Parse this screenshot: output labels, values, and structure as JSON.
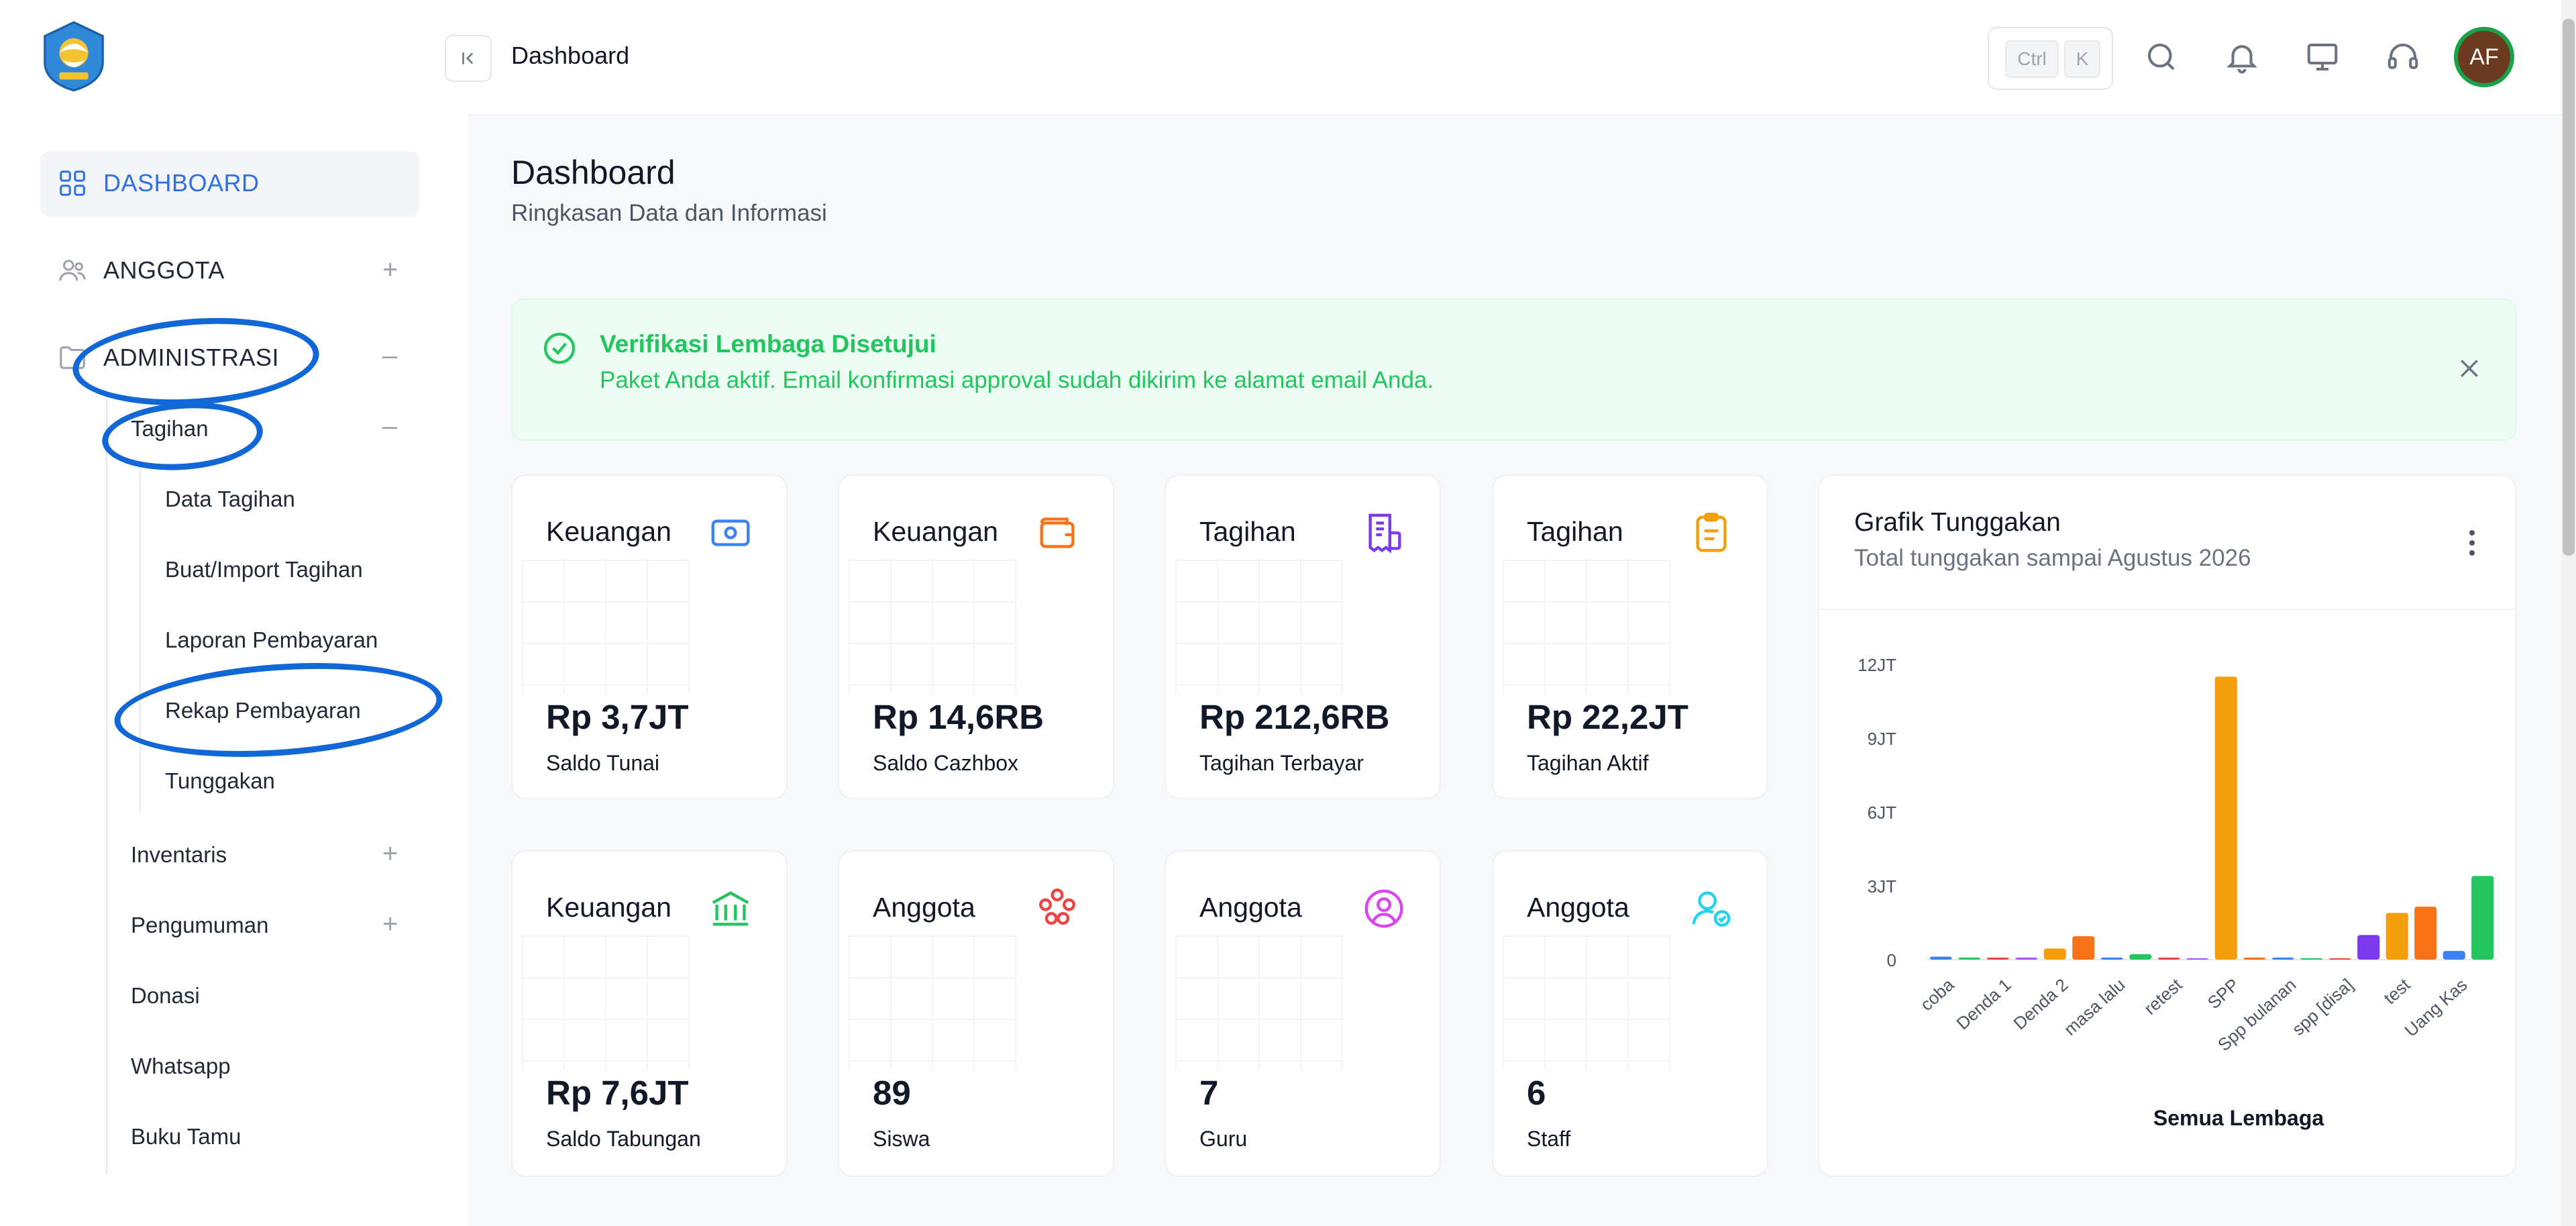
{
  "sidebar": {
    "items": [
      {
        "label": "DASHBOARD"
      },
      {
        "label": "ANGGOTA"
      },
      {
        "label": "ADMINISTRASI"
      }
    ],
    "admin_sub": [
      {
        "label": "Tagihan"
      },
      {
        "label": "Inventaris"
      },
      {
        "label": "Pengumuman"
      },
      {
        "label": "Donasi"
      },
      {
        "label": "Whatsapp"
      },
      {
        "label": "Buku Tamu"
      }
    ],
    "tagihan_sub": [
      {
        "label": "Data Tagihan"
      },
      {
        "label": "Buat/Import Tagihan"
      },
      {
        "label": "Laporan Pembayaran"
      },
      {
        "label": "Rekap Pembayaran"
      },
      {
        "label": "Tunggakan"
      }
    ]
  },
  "header": {
    "title": "Dashboard",
    "kbd": [
      "Ctrl",
      "K"
    ],
    "avatar_initials": "AF"
  },
  "page": {
    "title": "Dashboard",
    "subtitle": "Ringkasan Data dan Informasi"
  },
  "alert": {
    "title": "Verifikasi Lembaga Disetujui",
    "text": "Paket Anda aktif. Email konfirmasi approval sudah dikirim ke alamat email Anda."
  },
  "cards": [
    {
      "title": "Keuangan",
      "value": "Rp 3,7JT",
      "label": "Saldo Tunai",
      "icon": "cash-icon",
      "color": "#3b82f6"
    },
    {
      "title": "Keuangan",
      "value": "Rp 14,6RB",
      "label": "Saldo Cazhbox",
      "icon": "wallet-icon",
      "color": "#f97316"
    },
    {
      "title": "Tagihan",
      "value": "Rp 212,6RB",
      "label": "Tagihan Terbayar",
      "icon": "invoice-icon",
      "color": "#7c3aed"
    },
    {
      "title": "Tagihan",
      "value": "Rp 22,2JT",
      "label": "Tagihan Aktif",
      "icon": "clipboard-icon",
      "color": "#f59e0b"
    },
    {
      "title": "Keuangan",
      "value": "Rp 7,6JT",
      "label": "Saldo Tabungan",
      "icon": "bank-icon",
      "color": "#22c55e"
    },
    {
      "title": "Anggota",
      "value": "89",
      "label": "Siswa",
      "icon": "group-icon",
      "color": "#ef4444"
    },
    {
      "title": "Anggota",
      "value": "7",
      "label": "Guru",
      "icon": "user-circle-icon",
      "color": "#d946ef"
    },
    {
      "title": "Anggota",
      "value": "6",
      "label": "Staff",
      "icon": "user-check-icon",
      "color": "#22d3ee"
    }
  ],
  "chart": {
    "title": "Grafik Tunggakan",
    "subtitle": "Total tunggakan sampai Agustus 2026"
  },
  "chart_data": {
    "type": "bar",
    "xlabel": "Semua Lembaga",
    "ylabel": "",
    "ylim": [
      0,
      12000000
    ],
    "yticks": [
      0,
      3000000,
      6000000,
      9000000,
      12000000
    ],
    "ytick_labels": [
      "0",
      "3JT",
      "6JT",
      "9JT",
      "12JT"
    ],
    "categories": [
      "coba",
      "Denda 1",
      "Denda 2",
      "masa lalu",
      "retest",
      "SPP",
      "Spp bulanan",
      "spp [disa]",
      "test",
      "Uang Kas"
    ],
    "category_labels_shown": [
      "coba",
      "Denda 1",
      "Denda 2",
      "masa lalu",
      "retest",
      "SPP",
      "Spp bulanan",
      "spp [disa]",
      "test",
      "Uang Kas"
    ],
    "bars": [
      {
        "value": 120000,
        "color": "#3b82f6"
      },
      {
        "value": 80000,
        "color": "#22c55e"
      },
      {
        "value": 40000,
        "color": "#ef4444"
      },
      {
        "value": 40000,
        "color": "#a855f7"
      },
      {
        "value": 450000,
        "color": "#f59e0b"
      },
      {
        "value": 950000,
        "color": "#f97316"
      },
      {
        "value": 20000,
        "color": "#3b82f6"
      },
      {
        "value": 220000,
        "color": "#22c55e"
      },
      {
        "value": 20000,
        "color": "#ef4444"
      },
      {
        "value": 0,
        "color": "#a855f7"
      },
      {
        "value": 11500000,
        "color": "#f59e0b"
      },
      {
        "value": 80000,
        "color": "#f97316"
      },
      {
        "value": 60000,
        "color": "#3b82f6"
      },
      {
        "value": 0,
        "color": "#22c55e"
      },
      {
        "value": 0,
        "color": "#ef4444"
      },
      {
        "value": 1000000,
        "color": "#7c3aed"
      },
      {
        "value": 1900000,
        "color": "#f59e0b"
      },
      {
        "value": 2150000,
        "color": "#f97316"
      },
      {
        "value": 350000,
        "color": "#3b82f6"
      },
      {
        "value": 3400000,
        "color": "#22c55e"
      }
    ],
    "grid": false,
    "legend": "none"
  }
}
